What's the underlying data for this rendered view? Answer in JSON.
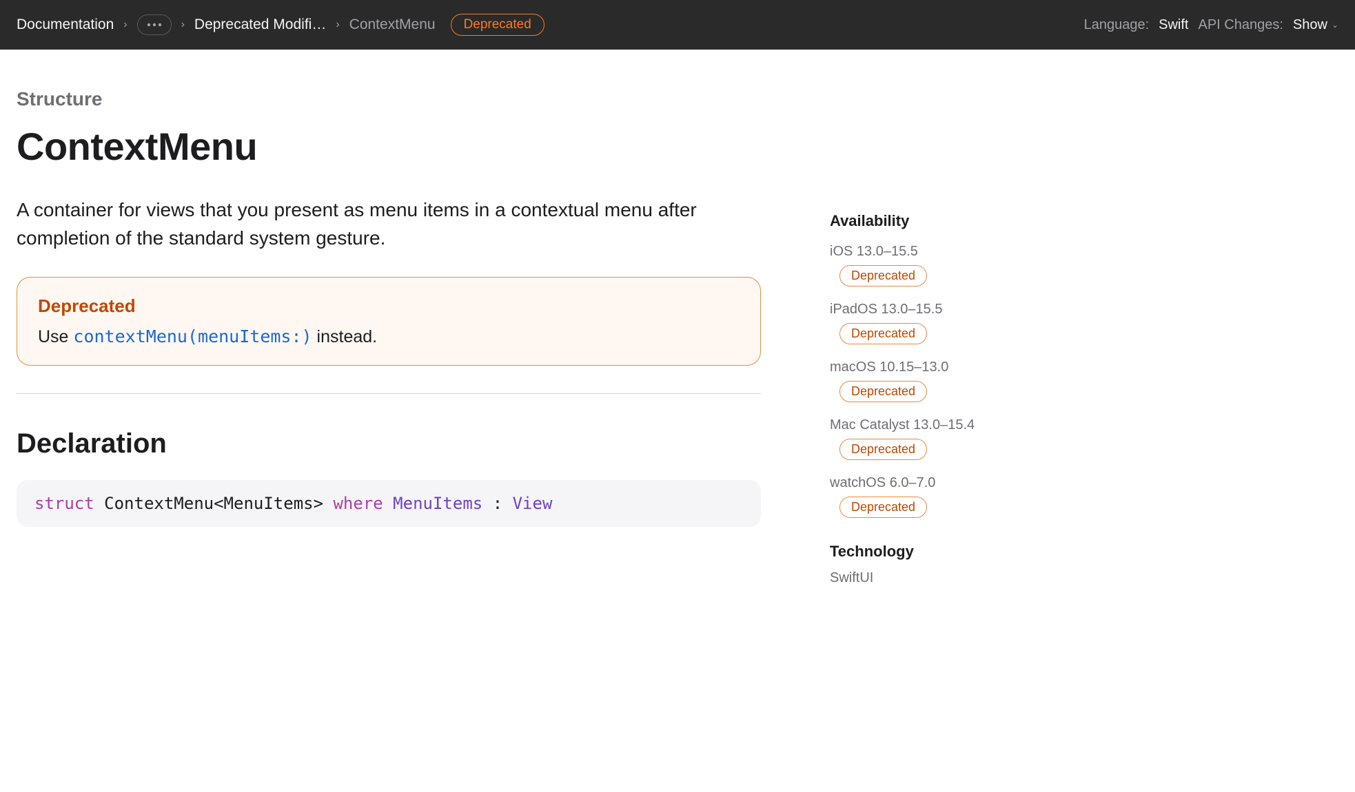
{
  "topbar": {
    "breadcrumb": {
      "root": "Documentation",
      "middle": "Deprecated Modifi…",
      "current": "ContextMenu"
    },
    "badge": "Deprecated",
    "language_label": "Language:",
    "language_value": "Swift",
    "api_changes_label": "API Changes:",
    "api_changes_value": "Show"
  },
  "main": {
    "eyebrow": "Structure",
    "title": "ContextMenu",
    "abstract": "A container for views that you present as menu items in a contextual menu after completion of the standard system gesture.",
    "callout": {
      "title": "Deprecated",
      "prefix": "Use ",
      "code": "contextMenu(menuItems:)",
      "suffix": " instead."
    },
    "declaration_heading": "Declaration",
    "declaration_code": {
      "kw1": "struct",
      "name": " ContextMenu<MenuItems> ",
      "kw2": "where",
      "generic": " MenuItems ",
      "colon": ": ",
      "proto": "View"
    }
  },
  "side": {
    "availability_heading": "Availability",
    "availability": [
      {
        "platform": "iOS 13.0–15.5",
        "badge": "Deprecated"
      },
      {
        "platform": "iPadOS 13.0–15.5",
        "badge": "Deprecated"
      },
      {
        "platform": "macOS 10.15–13.0",
        "badge": "Deprecated"
      },
      {
        "platform": "Mac Catalyst 13.0–15.4",
        "badge": "Deprecated"
      },
      {
        "platform": "watchOS 6.0–7.0",
        "badge": "Deprecated"
      }
    ],
    "technology_heading": "Technology",
    "technology_value": "SwiftUI"
  }
}
